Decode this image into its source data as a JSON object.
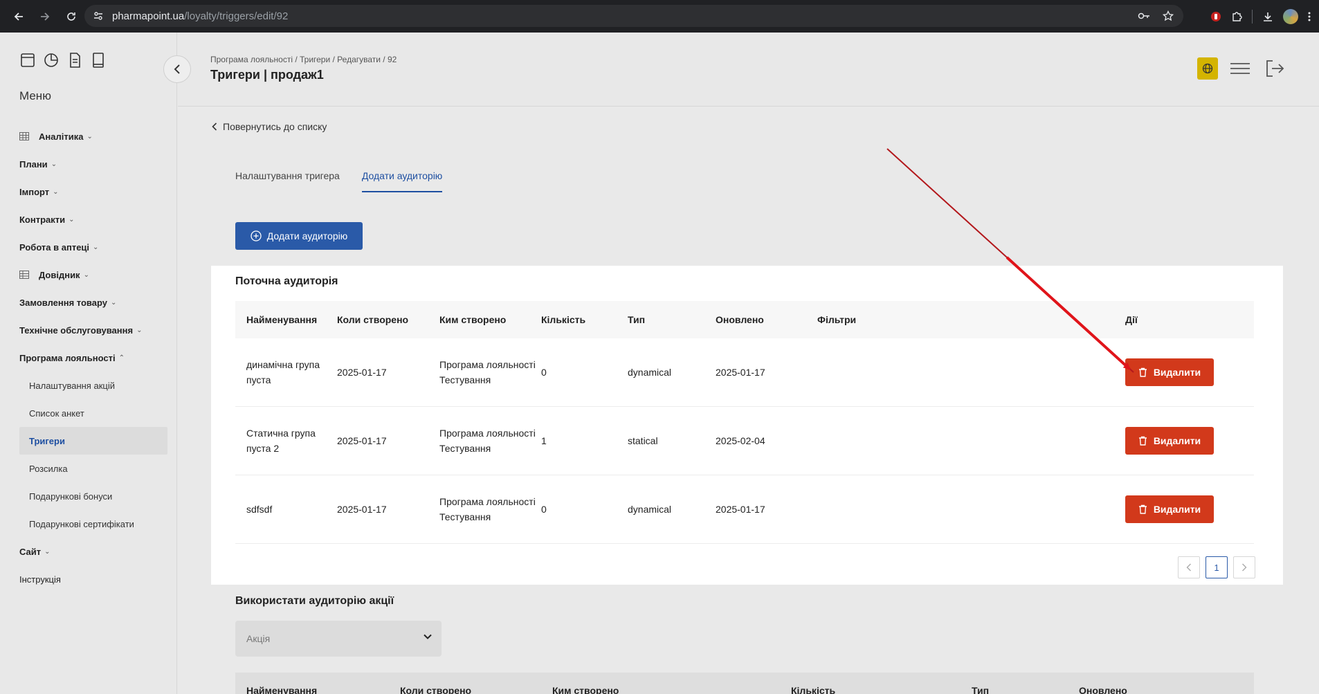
{
  "browser": {
    "url_host": "pharmapoint.ua",
    "url_path": "/loyalty/triggers/edit/92"
  },
  "sidebar": {
    "menu_title": "Меню",
    "items": [
      {
        "label": "Аналітика",
        "chevron": "⌄"
      },
      {
        "label": "Плани",
        "chevron": "⌄"
      },
      {
        "label": "Імпорт",
        "chevron": "⌄"
      },
      {
        "label": "Контракти",
        "chevron": "⌄"
      },
      {
        "label": "Робота в аптеці",
        "chevron": "⌄"
      },
      {
        "label": "Довідник",
        "chevron": "⌄"
      },
      {
        "label": "Замовлення товару",
        "chevron": "⌄"
      },
      {
        "label": "Технічне обслуговування",
        "chevron": "⌄"
      },
      {
        "label": "Програма лояльності",
        "chevron": "⌃"
      }
    ],
    "subitems": [
      {
        "label": "Налаштування акцій"
      },
      {
        "label": "Список анкет"
      },
      {
        "label": "Тригери"
      },
      {
        "label": "Розсилка"
      },
      {
        "label": "Подарункові бонуси"
      },
      {
        "label": "Подарункові сертифікати"
      }
    ],
    "bottom_items": [
      {
        "label": "Сайт",
        "chevron": "⌄"
      },
      {
        "label": "Інструкція"
      }
    ]
  },
  "header": {
    "breadcrumb": "Програма лояльності / Тригери / Редагувати / 92",
    "title": "Тригери | продаж1"
  },
  "back_link": "Повернутись до списку",
  "tabs": [
    {
      "label": "Налаштування тригера"
    },
    {
      "label": "Додати аудиторію"
    }
  ],
  "add_audience_button": "Додати аудиторію",
  "current_audience": {
    "title": "Поточна аудиторія",
    "columns": [
      "Найменування",
      "Коли створено",
      "Ким створено",
      "Кількість",
      "Тип",
      "Оновлено",
      "Фільтри",
      "Дії"
    ],
    "rows": [
      {
        "name": "динамічна група пуста",
        "created": "2025-01-17",
        "creator": "Програма лояльності Тестування",
        "count": "0",
        "type": "dynamical",
        "updated": "2025-01-17",
        "filters": "",
        "action": "Видалити"
      },
      {
        "name": "Статична група пуста 2",
        "created": "2025-01-17",
        "creator": "Програма лояльності Тестування",
        "count": "1",
        "type": "statical",
        "updated": "2025-02-04",
        "filters": "",
        "action": "Видалити"
      },
      {
        "name": "sdfsdf",
        "created": "2025-01-17",
        "creator": "Програма лояльності Тестування",
        "count": "0",
        "type": "dynamical",
        "updated": "2025-01-17",
        "filters": "",
        "action": "Видалити"
      }
    ],
    "pagination": {
      "current_page": "1"
    }
  },
  "use_audience": {
    "title": "Використати аудиторію акції",
    "select_placeholder": "Акція",
    "columns": [
      "Найменування",
      "Коли створено",
      "Ким створено",
      "Кількість",
      "Тип",
      "Оновлено"
    ]
  },
  "colors": {
    "primary": "#2a5aa8",
    "danger": "#d2391b",
    "annotation_arrow": "#c81a1a",
    "globe_button": "#d4b400"
  }
}
